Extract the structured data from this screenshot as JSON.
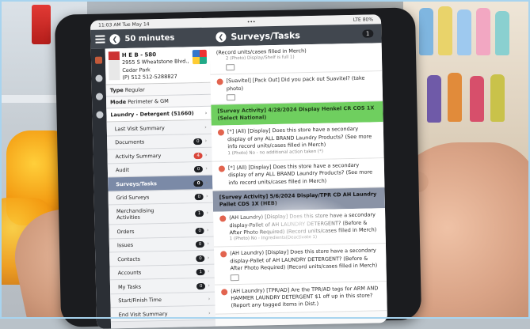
{
  "status_bar": {
    "time": "11:03 AM  Tue May 14",
    "dots": "•••",
    "battery": "LTE 80%"
  },
  "header": {
    "duration": "50 minutes",
    "title": "Surveys/Tasks",
    "count": "1"
  },
  "store": {
    "name": "H E B - 580",
    "address": "2955 S Wheatstone Blvd., Cedar Park",
    "phone": "(P) 512 512-5288827",
    "type_label": "Type",
    "type_value": "Regular",
    "mode_label": "Mode",
    "mode_value": "Perimeter & GM",
    "selected": "Laundry - Detergent (51660)"
  },
  "nav": [
    {
      "label": "Last Visit Summary",
      "badge": ""
    },
    {
      "label": "Documents",
      "badge": "0"
    },
    {
      "label": "Activity Summary",
      "badge": "4",
      "badge_color": "#d9473b"
    },
    {
      "label": "Audit",
      "badge": "0"
    },
    {
      "label": "Surveys/Tasks",
      "badge": "0"
    },
    {
      "label": "Grid Surveys",
      "badge": "0"
    },
    {
      "label": "Merchandising Activities",
      "badge": "1"
    },
    {
      "label": "Orders",
      "badge": "0"
    },
    {
      "label": "Issues",
      "badge": "0"
    },
    {
      "label": "Contacts",
      "badge": "0"
    },
    {
      "label": "Accounts",
      "badge": "1"
    },
    {
      "label": "My Tasks",
      "badge": "0"
    },
    {
      "label": "Start/Finish Time",
      "badge": ""
    },
    {
      "label": "End Visit Summary",
      "badge": ""
    }
  ],
  "main": {
    "top_question": "(Record units/cases filled in Merch)",
    "top_sub": "2 (Photo) Display/Shelf is full 1)",
    "q_suavitel": "[Suavitel] [Pack Out] Did you pack out Suavitel? (take photo)",
    "survey1_header": "[Survey Activity] 4/28/2024 Display Henkel CR COS 1X (Select National)",
    "q_all_brand_1": "[*] (All) [Display] Does this store have a secondary display of any ALL BRAND Laundry Products? (See more info record units/cases filled in Merch)",
    "q_all_brand_1_sub": "1 (Photo) No - no additional action taken (*)",
    "q_all_brand_2": "[*] (All) [Display] Does this store have a secondary display of any ALL BRAND Laundry Products? (See more info record units/cases filled in Merch)",
    "survey2_header": "[Survey Activity] 5/6/2024 Display/TPR CD AH Laundry Pallet CDS 1X (HEB)",
    "q_ah_1": "(AH Laundry) [Display] Does this store have a secondary display-Pallet of AH LAUNDRY DETERGENT? (Before & After Photo Required) (Record units/cases filled in Merch)",
    "q_ah_1_sub": "1 (Photo) No - Ingredients(Deactivate 1)",
    "q_ah_2": "(AH Laundry) [Display] Does this store have a secondary display-Pallet of AH LAUNDRY DETERGENT? (Before & After Photo Required) (Record units/cases filled in Merch)",
    "q_ah_3": "(AH Laundry) [TPR/AD] Are the TPR/AD tags for ARM AND HAMMER LAUNDRY DETERGENT $1 off up in this store? (Report any tagged items in Dist.)"
  },
  "colors": {
    "header_bg": "#41474f",
    "green_band": "#6fcf5f",
    "gray_band": "#8a93a6",
    "active_nav": "#7b8aa7"
  },
  "icons": [
    "menu-icon",
    "back-arrow-icon",
    "camera-icon",
    "chevron-right-icon",
    "map-icon"
  ]
}
